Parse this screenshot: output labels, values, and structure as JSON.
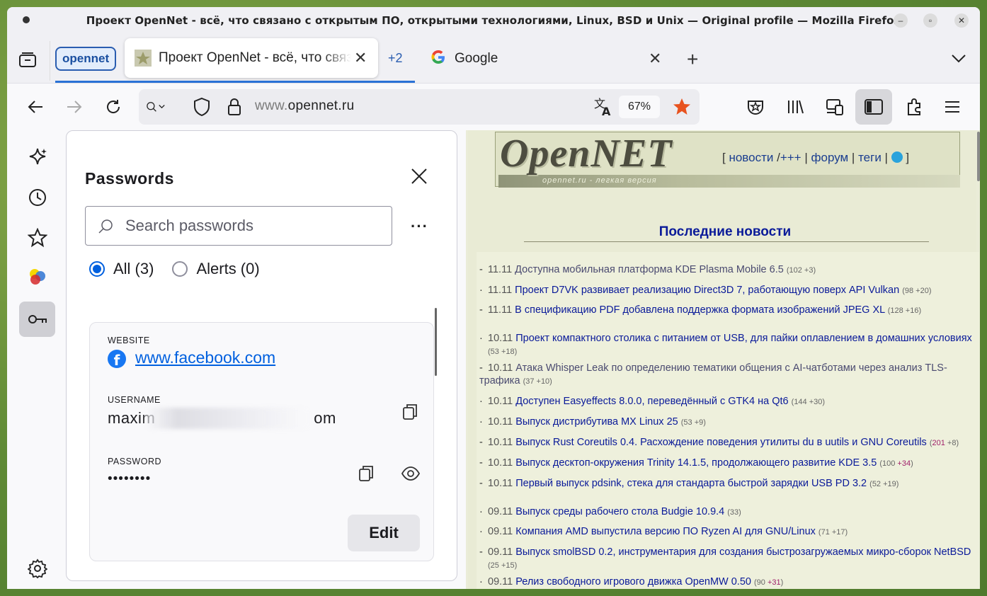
{
  "window": {
    "title": "Проект OpenNet - всё, что связано с открытым ПО, открытыми технологиями, Linux, BSD и Unix — Original profile — Mozilla Firefox"
  },
  "tabs": {
    "group_label": "opennet",
    "active_tab": "Проект OpenNet - всё, что связано с открытым ПО",
    "more_count": "+2",
    "google_tab": "Google"
  },
  "navbar": {
    "url_prefix": "www.",
    "url_domain": "opennet.ru",
    "zoom": "67%"
  },
  "passwords": {
    "title": "Passwords",
    "search_placeholder": "Search passwords",
    "more": "···",
    "filter_all": "All (3)",
    "filter_alerts": "Alerts (0)",
    "website_label": "WEBSITE",
    "website": "www.facebook.com",
    "username_label": "USERNAME",
    "username_visible": "maxim",
    "username_tail": "om",
    "password_label": "PASSWORD",
    "password_masked": "••••••••",
    "edit_label": "Edit"
  },
  "site": {
    "logo": "OpenNET",
    "logo_sub": "opennet.ru - легкая версия",
    "nav_open": "[ ",
    "nav_news": "новости",
    "nav_sep1": " /",
    "nav_plus": "+++",
    "nav_sep2": " | ",
    "nav_forum": "форум",
    "nav_sep3": " | ",
    "nav_tags": "теги",
    "nav_sep4": " | ",
    "nav_close": " ]",
    "news_heading": "Последние новости",
    "news": [
      {
        "date": "11.11",
        "title": "Доступна мобильная платформа KDE Plasma Mobile 6.5",
        "count": "(102 +3)",
        "visited": true
      },
      {
        "date": "11.11",
        "title": "Проект D7VK развивает реализацию Direct3D 7, работающую поверх API Vulkan",
        "count": "(98 +20)",
        "visited": false
      },
      {
        "date": "11.11",
        "title": "В спецификацию PDF добавлена поддержка формата изображений JPEG XL",
        "count": "(128 +16)",
        "visited": false
      },
      {
        "date": "10.11",
        "title": "Проект компактного столика с питанием от USB, для пайки оплавлением в домашних условиях",
        "count": "(53 +18)",
        "visited": false
      },
      {
        "date": "10.11",
        "title": "Атака Whisper Leak по определению тематики общения с AI-чатботами через анализ TLS-трафика",
        "count": "(37 +10)",
        "visited": true
      },
      {
        "date": "10.11",
        "title": "Доступен Easyeffects 8.0.0, переведённый с GTK4 на Qt6",
        "count": "(144 +30)",
        "visited": false
      },
      {
        "date": "10.11",
        "title": "Выпуск дистрибутива MX Linux 25",
        "count": "(53 +9)",
        "visited": false
      },
      {
        "date": "10.11",
        "title": "Выпуск Rust Coreutils 0.4. Расхождение поведения утилиты du в uutils и GNU Coreutils",
        "count_hot": "201",
        "count_tail": " +8)",
        "visited": false
      },
      {
        "date": "10.11",
        "title": "Выпуск десктоп-окружения Trinity 14.1.5, продолжающего развитие KDE 3.5",
        "count_head": "(100 ",
        "count_hot": "+34",
        "count_tail": ")",
        "visited": false
      },
      {
        "date": "10.11",
        "title": "Первый выпуск pdsink, стека для стандарта быстрой зарядки USB PD 3.2",
        "count": "(52 +19)",
        "visited": false
      },
      {
        "date": "09.11",
        "title": "Выпуск среды рабочего стола Budgie 10.9.4",
        "count": "(33)",
        "visited": false
      },
      {
        "date": "09.11",
        "title": "Компания AMD выпустила версию ПО Ryzen AI для GNU/Linux",
        "count": "(71 +17)",
        "visited": false
      },
      {
        "date": "09.11",
        "title": "Выпуск smolBSD 0.2, инструментария для создания быстрозагружаемых микро-сборок NetBSD",
        "count": "(25 +15)",
        "visited": false
      },
      {
        "date": "09.11",
        "title": "Релиз свободного игрового движка OpenMW 0.50",
        "count_head": "(90 ",
        "count_hot": "+31",
        "count_tail": ")",
        "visited": false
      }
    ]
  }
}
